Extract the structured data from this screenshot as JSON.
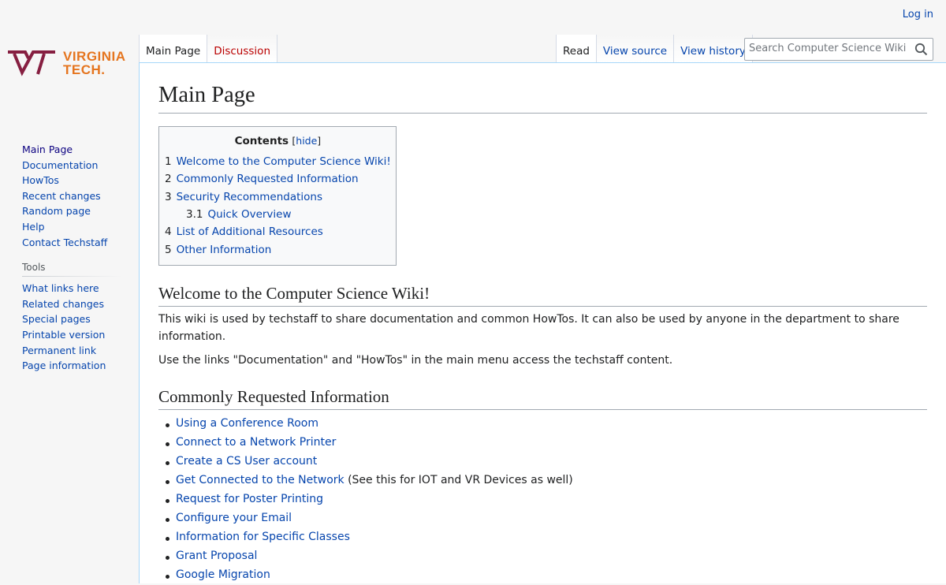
{
  "personal": {
    "login_label": "Log in"
  },
  "logo": {
    "text_line1": "VIRGINIA",
    "text_line2": "TECH.",
    "maroon": "#861f41",
    "orange": "#e5751f"
  },
  "sidebar": {
    "nav": [
      "Main Page",
      "Documentation",
      "HowTos",
      "Recent changes",
      "Random page",
      "Help",
      "Contact Techstaff"
    ],
    "tools_heading": "Tools",
    "tools": [
      "What links here",
      "Related changes",
      "Special pages",
      "Printable version",
      "Permanent link",
      "Page information"
    ]
  },
  "tabs": {
    "left": [
      "Main Page",
      "Discussion"
    ],
    "right": [
      "Read",
      "View source",
      "View history"
    ]
  },
  "search": {
    "placeholder": "Search Computer Science Wiki",
    "icon": "search-icon"
  },
  "page": {
    "title": "Main Page",
    "toc": {
      "title": "Contents",
      "hide_label": "hide",
      "items": [
        {
          "num": "1",
          "label": "Welcome to the Computer Science Wiki!"
        },
        {
          "num": "2",
          "label": "Commonly Requested Information"
        },
        {
          "num": "3",
          "label": "Security Recommendations"
        },
        {
          "num": "3.1",
          "label": "Quick Overview"
        },
        {
          "num": "4",
          "label": "List of Additional Resources"
        },
        {
          "num": "5",
          "label": "Other Information"
        }
      ]
    },
    "welcome": {
      "heading": "Welcome to the Computer Science Wiki!",
      "para1": "This wiki is used by techstaff to share documentation and common HowTos. It can also be used by anyone in the department to share information.",
      "para2": "Use the links \"Documentation\" and \"HowTos\" in the main menu access the techstaff content."
    },
    "common": {
      "heading": "Commonly Requested Information",
      "items": [
        "Using a Conference Room",
        "Connect to a Network Printer",
        "Create a CS User account",
        "Get Connected to the Network",
        "Request for Poster Printing",
        "Configure your Email",
        "Information for Specific Classes",
        "Grant Proposal",
        "Google Migration"
      ],
      "network_note": " (See this for IOT and VR Devices as well)"
    }
  }
}
